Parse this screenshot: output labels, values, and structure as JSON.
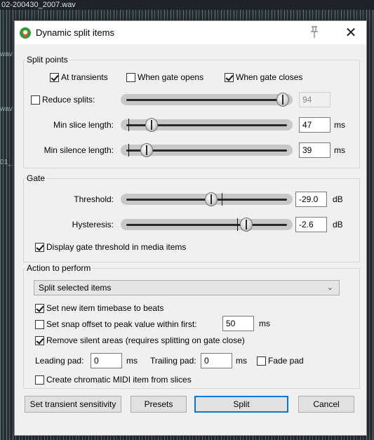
{
  "background": {
    "track_title": "02-200430_2007.wav",
    "side_texts": [
      "wav",
      "wav",
      "01_"
    ]
  },
  "dialog": {
    "title": "Dynamic split items",
    "split_points": {
      "label": "Split points",
      "at_transients": "At transients",
      "at_transients_checked": true,
      "gate_opens": "When gate opens",
      "gate_opens_checked": false,
      "gate_closes": "When gate closes",
      "gate_closes_checked": true,
      "reduce_splits": "Reduce splits:",
      "reduce_splits_checked": false,
      "reduce_splits_value": "94",
      "min_slice_label": "Min slice length:",
      "min_slice_value": "47",
      "min_slice_unit": "ms",
      "min_silence_label": "Min silence length:",
      "min_silence_value": "39",
      "min_silence_unit": "ms",
      "sliders": {
        "reduce": 0.98,
        "min_slice": 0.15,
        "min_silence": 0.12
      }
    },
    "gate": {
      "label": "Gate",
      "threshold_label": "Threshold:",
      "threshold_value": "-29.0",
      "threshold_unit": "dB",
      "hysteresis_label": "Hysteresis:",
      "hysteresis_value": "-2.6",
      "hysteresis_unit": "dB",
      "display_threshold": "Display gate threshold in media items",
      "display_threshold_checked": true,
      "sliders": {
        "threshold": 0.53,
        "hysteresis": 0.75
      }
    },
    "action": {
      "label": "Action to perform",
      "selected": "Split selected items",
      "timebase": "Set new item timebase to beats",
      "timebase_checked": true,
      "snap_offset": "Set snap offset to peak value within first:",
      "snap_offset_checked": false,
      "snap_offset_value": "50",
      "snap_offset_unit": "ms",
      "remove_silent": "Remove silent areas (requires splitting on gate close)",
      "remove_silent_checked": true,
      "leading_pad_label": "Leading pad:",
      "leading_pad_value": "0",
      "leading_pad_unit": "ms",
      "trailing_pad_label": "Trailing pad:",
      "trailing_pad_value": "0",
      "trailing_pad_unit": "ms",
      "fade_pad": "Fade pad",
      "fade_pad_checked": false,
      "chromatic_midi": "Create chromatic MIDI item from slices",
      "chromatic_midi_checked": false
    },
    "buttons": {
      "transient_sensitivity": "Set transient sensitivity",
      "presets": "Presets",
      "split": "Split",
      "cancel": "Cancel"
    }
  }
}
